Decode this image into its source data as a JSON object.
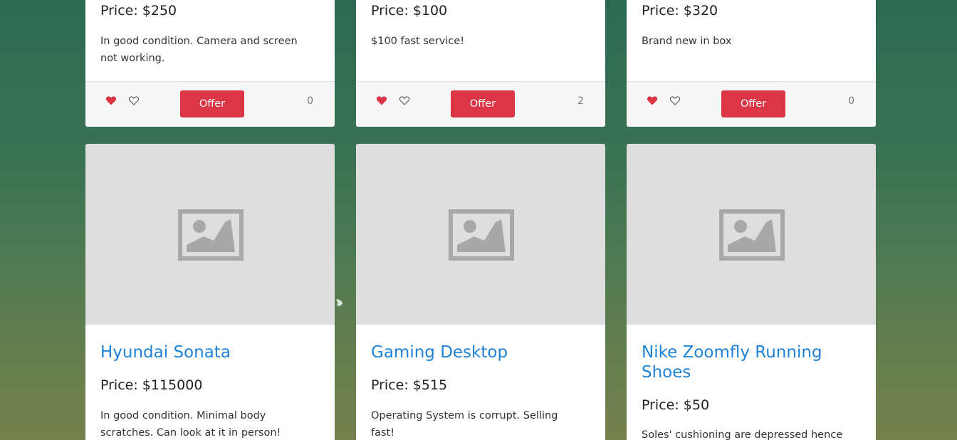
{
  "colors": {
    "accent_red": "#dc3545",
    "title_blue": "#1f82d6",
    "placeholder_bg": "#dedede",
    "placeholder_icon": "#a8a8a8"
  },
  "top_cards": [
    {
      "price": "Price: $250",
      "description": "In good condition. Camera and screen not working.",
      "offer_label": "Offer",
      "like_count": "0"
    },
    {
      "price": "Price: $100",
      "description": "$100 fast service!",
      "offer_label": "Offer",
      "like_count": "2"
    },
    {
      "price": "Price: $320",
      "description": "Brand new in box",
      "offer_label": "Offer",
      "like_count": "0"
    }
  ],
  "bottom_cards": [
    {
      "title": "Hyundai Sonata",
      "price": "Price: $115000",
      "description": "In good condition. Minimal body scratches. Can look at it in person!"
    },
    {
      "title": "Gaming Desktop",
      "price": "Price: $515",
      "description": "Operating System is corrupt. Selling fast!"
    },
    {
      "title": "Nike Zoomfly Running Shoes",
      "price": "Price: $50",
      "description": "Soles' cushioning are depressed hence"
    }
  ]
}
